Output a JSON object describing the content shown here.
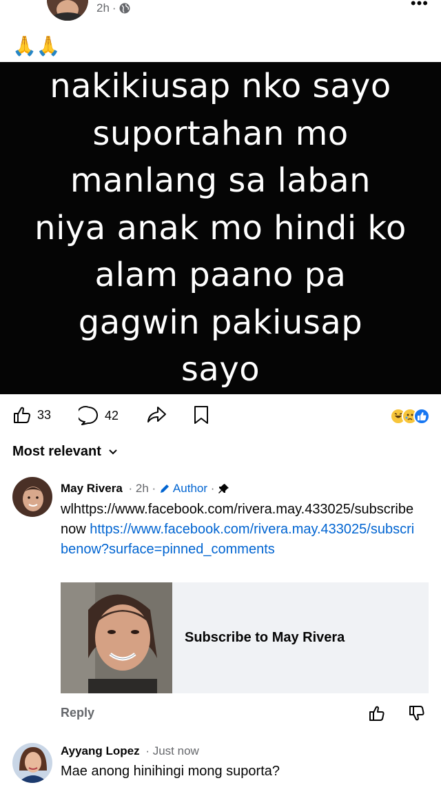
{
  "post": {
    "time": "2h",
    "caption": "🙏🙏",
    "text_lines": [
      "nakikiusap nko sayo",
      "suportahan mo",
      "manlang sa laban",
      "niya anak mo hindi ko",
      "alam paano pa",
      "gagwin pakiusap",
      "sayo"
    ],
    "background": "#050505"
  },
  "actions": {
    "likes": "33",
    "comments": "42",
    "reactions": [
      "laugh-emoji",
      "sad-emoji",
      "like-emoji"
    ]
  },
  "sort": {
    "label": "Most relevant"
  },
  "comments": [
    {
      "author": "May Rivera",
      "time": "2h",
      "badge": "Author",
      "body_plain": "wlhttps://www.facebook.com/rivera.may.433025/subscribenow ",
      "body_link": "https://www.facebook.com/rivera.may.433025/subscribenow?surface=pinned_comments",
      "card_title": "Subscribe to May Rivera",
      "reply_label": "Reply"
    },
    {
      "author": "Ayyang Lopez",
      "time": "Just now",
      "body": "Mae anong hinihingi mong suporta?"
    }
  ],
  "colors": {
    "link": "#0064d1",
    "meta": "#65676b",
    "card_bg": "#f0f2f5"
  }
}
